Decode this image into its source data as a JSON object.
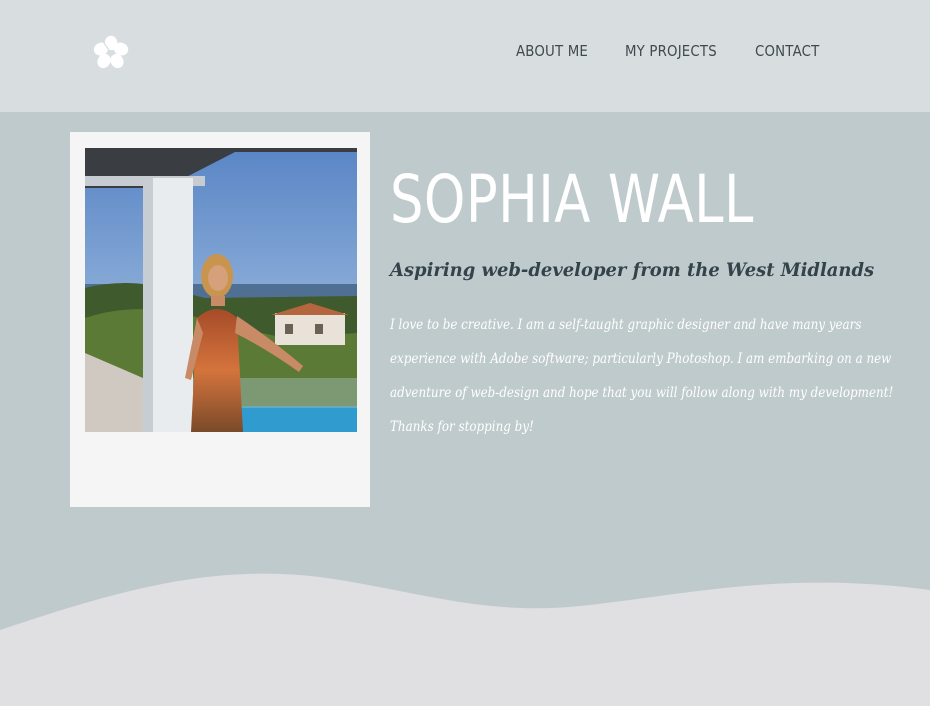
{
  "nav": {
    "logo_icon": "hibiscus-flower-icon",
    "items": [
      {
        "label": "ABOUT ME"
      },
      {
        "label": "MY PROJECTS"
      },
      {
        "label": "CONTACT"
      }
    ]
  },
  "hero": {
    "name": "SOPHIA WALL",
    "tagline": "Aspiring web-developer from the West Midlands",
    "bio_lines": [
      "I love to be creative. I am a self-taught graphic designer and have many years",
      "experience with Adobe software; particularly Photoshop. I am embarking on a new",
      "adventure of web-design and hope that you will follow along with my development!",
      "Thanks for stopping by!"
    ]
  },
  "colors": {
    "header_bg": "#d8dde0",
    "page_bg": "#bfcacc",
    "wave_bg": "#e0dfe2",
    "nav_text": "#3f4a4f",
    "tagline_text": "#34434a",
    "name_text": "#ffffff"
  }
}
